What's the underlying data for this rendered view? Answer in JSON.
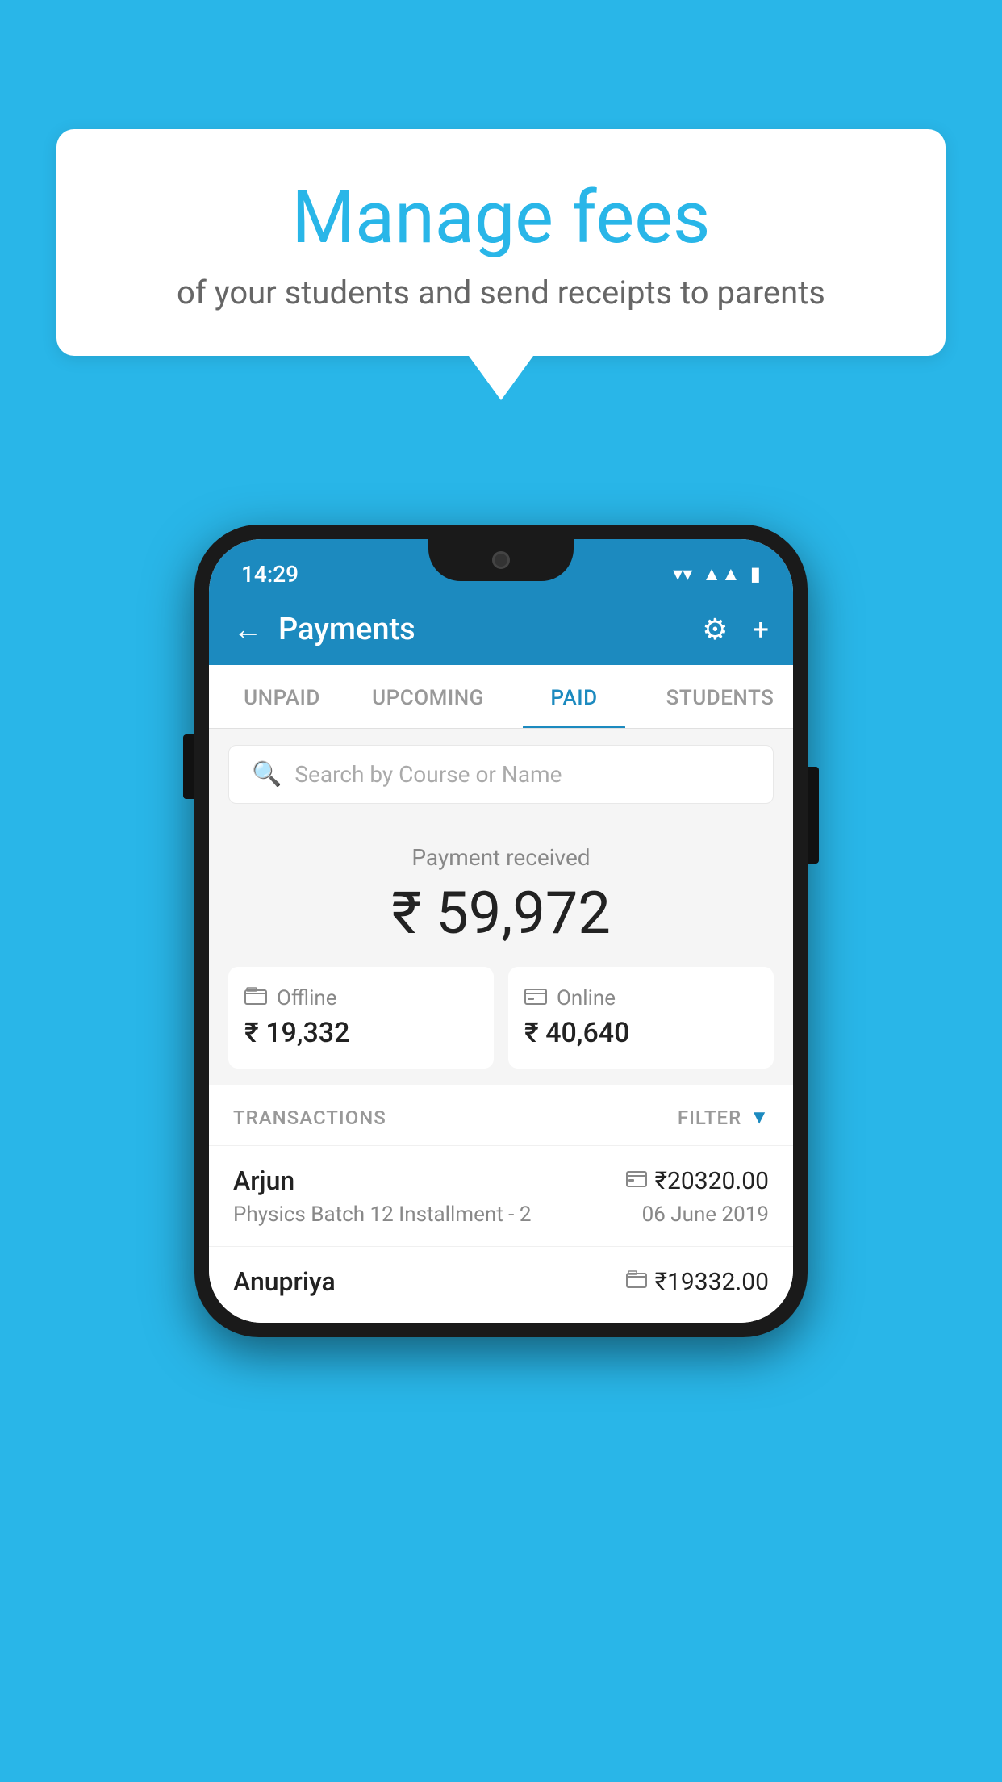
{
  "background": {
    "color": "#29b6e8"
  },
  "speech_bubble": {
    "title": "Manage fees",
    "subtitle": "of your students and send receipts to parents"
  },
  "status_bar": {
    "time": "14:29",
    "icons": [
      "wifi",
      "signal",
      "battery"
    ]
  },
  "header": {
    "title": "Payments",
    "back_label": "←",
    "gear_label": "⚙",
    "plus_label": "+"
  },
  "tabs": [
    {
      "label": "UNPAID",
      "active": false
    },
    {
      "label": "UPCOMING",
      "active": false
    },
    {
      "label": "PAID",
      "active": true
    },
    {
      "label": "STUDENTS",
      "active": false
    }
  ],
  "search": {
    "placeholder": "Search by Course or Name"
  },
  "payment_summary": {
    "label": "Payment received",
    "amount": "₹ 59,972",
    "offline": {
      "icon": "💳",
      "label": "Offline",
      "amount": "₹ 19,332"
    },
    "online": {
      "icon": "💳",
      "label": "Online",
      "amount": "₹ 40,640"
    }
  },
  "transactions": {
    "header_label": "TRANSACTIONS",
    "filter_label": "FILTER",
    "rows": [
      {
        "name": "Arjun",
        "amount": "₹20320.00",
        "course": "Physics Batch 12 Installment - 2",
        "date": "06 June 2019",
        "type": "online"
      },
      {
        "name": "Anupriya",
        "amount": "₹19332.00",
        "course": "",
        "date": "",
        "type": "offline"
      }
    ]
  }
}
